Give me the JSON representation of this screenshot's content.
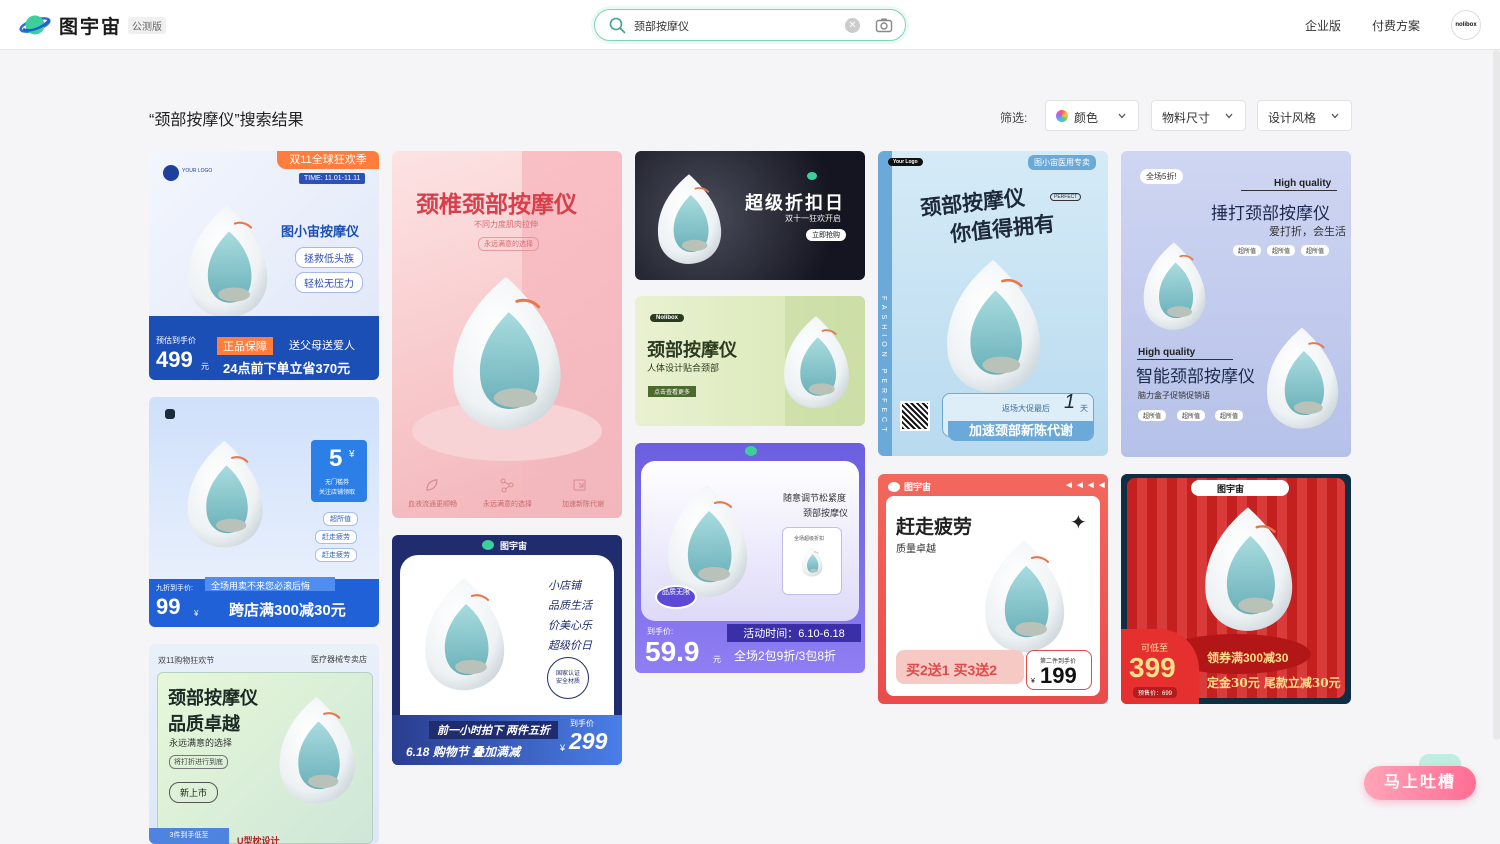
{
  "header": {
    "brand": "图宇宙",
    "beta_badge": "公测版",
    "search_value": "颈部按摩仪",
    "nav_enterprise": "企业版",
    "nav_pricing": "付费方案",
    "avatar_text": "nolibox"
  },
  "results": {
    "title": "“颈部按摩仪”搜索结果"
  },
  "filters": {
    "label": "筛选:",
    "color": "颜色",
    "size": "物料尺寸",
    "style": "设计风格"
  },
  "cards": {
    "c1": {
      "logo": "YOUR LOGO",
      "ribbon": "双11全球狂欢季",
      "time": "TIME: 11.01-11.11",
      "name": "图小宙按摩仪",
      "tag1": "拯救低头族",
      "tag2": "轻松无压力",
      "est": "预估到手价",
      "price": "499",
      "unit": "元",
      "guarantee": "正品保障",
      "gift": "送父母送爱人",
      "promo": "24点前下单立省370元"
    },
    "c2": {
      "title": "颈椎颈部按摩仪",
      "sub": "不同力度肌肉拉伸",
      "tag": "永远满意的选择",
      "f1": "血液流通更顺畅",
      "f2": "永远满意的选择",
      "f3": "加速新陈代谢"
    },
    "c3": {
      "title": "超级折扣日",
      "sub": "双十一狂欢开启",
      "btn": "立即抢购"
    },
    "c4": {
      "brand": "Nolibox",
      "title": "颈部按摩仪",
      "sub": "人体设计贴合颈部",
      "btn": "点击查看更多"
    },
    "c5": {
      "logo": "Your Logo",
      "tag": "图小宙医用专卖",
      "title1": "颈部按摩仪",
      "title2": "你值得拥有",
      "perfect": "PERFECT",
      "side": "FASHION PERFECT",
      "promo": "返场大促最后",
      "days": "1",
      "day_unit": "天",
      "slogan": "加速颈部新陈代谢"
    },
    "c6": {
      "badge": "全场5折!",
      "hq1": "High quality",
      "title1": "捶打颈部按摩仪",
      "sub1": "爱打折，会生活",
      "tag": "超所值",
      "hq2": "High quality",
      "title2": "智能颈部按摩仪",
      "sub2": "脑力盒子促销促销语"
    },
    "c7": {
      "num": "5",
      "sym": "¥",
      "badge_l1": "无门槛券",
      "badge_l2": "关注店铺领取",
      "t1": "超所值",
      "t2": "赶走疲劳",
      "t3": "赶走疲劳",
      "est": "九折到手价:",
      "strip": "全场用卖不来您必滚后悔",
      "price": "99",
      "unit": "¥",
      "promo": "跨店满300减30元"
    },
    "c8": {
      "brand": "图宇宙",
      "l1": "小店铺",
      "l2": "品质生活",
      "l3": "价美心乐",
      "l4": "超级价日",
      "seal": "国家认证 安全材质",
      "strip": "前一小时拍下 两件五折",
      "date": "6.18 购物节  叠加满减",
      "price_label": "到手价",
      "price": "299",
      "unit": "¥"
    },
    "c9": {
      "text1": "随意调节松紧度",
      "text2": "颈部按摩仪",
      "mini": "全场超级折扣",
      "stamp": "品质无限",
      "label": "到手价:",
      "price": "59.9",
      "unit": "元",
      "time": "活动时间：6.10-6.18",
      "promo": "全场2包9折/3包8折"
    },
    "c10": {
      "brand": "图宇宙",
      "title": "赶走疲劳",
      "sub": "质量卓越",
      "deal": "买2送1 买3送2",
      "label": "第二件到手价",
      "price": "199",
      "unit": "¥"
    },
    "c11": {
      "brand": "图宇宙",
      "low": "可低至",
      "price": "399",
      "pre": "预售价：699",
      "coupon": "领券满300减30",
      "promo": "定金30元 尾款立减30元"
    },
    "c12": {
      "tl": "双11购物狂欢节",
      "tr": "医疗器械专卖店",
      "title1": "颈部按摩仪",
      "title2": "品质卓越",
      "sub": "永远满意的选择",
      "tag": "将打折进行到底",
      "new": "新上市",
      "bottom1": "3件到手低至",
      "bottom2": "U型枕设计"
    }
  },
  "feedback": "马上吐槽",
  "colors": {
    "accent": "#2fb98e",
    "brand_blue": "#1c4fb5",
    "pink": "#ff6d93"
  }
}
